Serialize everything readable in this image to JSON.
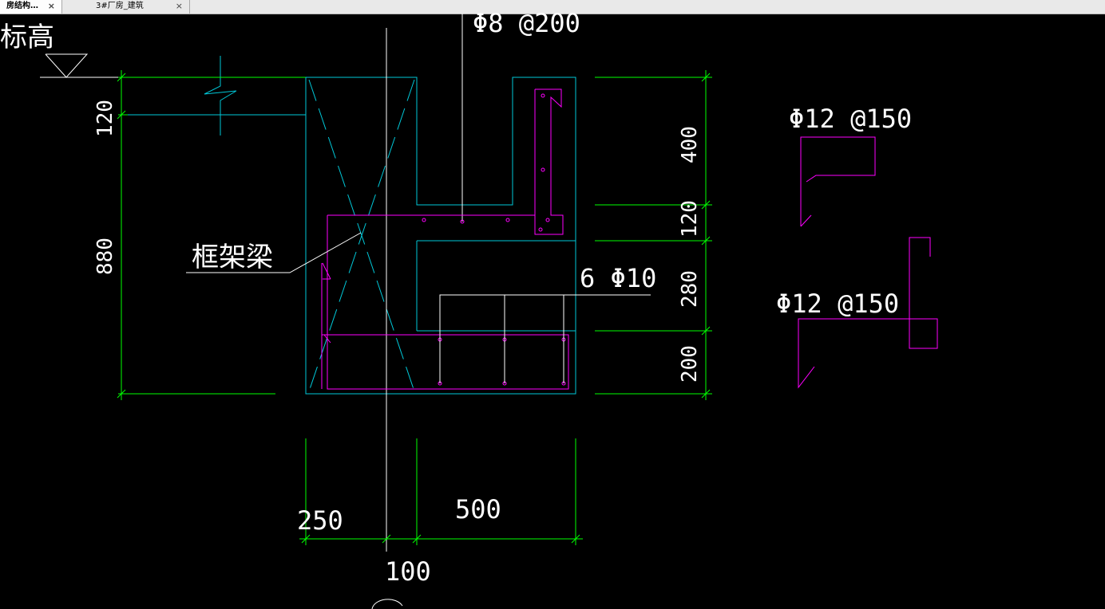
{
  "tabs": [
    {
      "label": "房结构…",
      "close": "×"
    },
    {
      "label": "3#厂房_建筑",
      "close": "×"
    }
  ],
  "colors": {
    "background": "#000000",
    "dim": "#00ff00",
    "outline": "#00c8d8",
    "rebar": "#ff00ff",
    "text": "#ffffff"
  },
  "drawing": {
    "elevation_label": "标高",
    "top_rebar_label": "Φ8 @200",
    "beam_label": "框架梁",
    "bottom_rebar_label": "6 Φ10",
    "detail1_label": "Φ12 @150",
    "detail2_label": "Φ12 @150",
    "dims_left": [
      "120",
      "880"
    ],
    "dims_right": [
      "400",
      "120",
      "280",
      "200"
    ],
    "dims_bottom": [
      "250",
      "500",
      "100"
    ]
  }
}
